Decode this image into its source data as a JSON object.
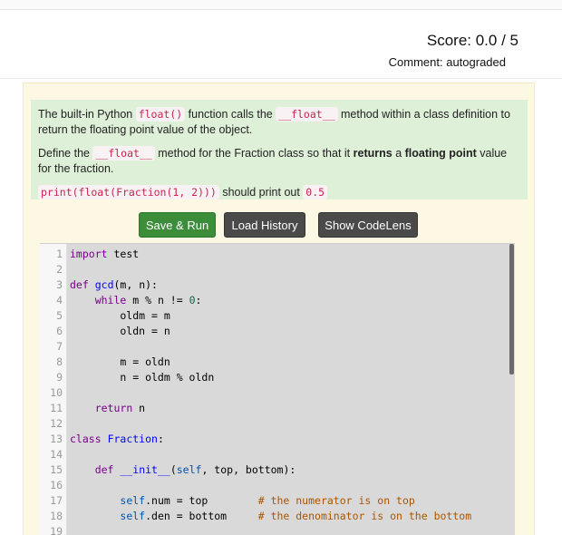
{
  "score": {
    "text": "Score: 0.0 / 5"
  },
  "comment": {
    "text": "Comment: autograded"
  },
  "prompt": {
    "p1_a": "The built-in Python ",
    "p1_code1": "float()",
    "p1_b": " function calls the ",
    "p1_code2": "__float__",
    "p1_c": " method within a class definition to return the floating point value of the object.",
    "p2_a": "Define the ",
    "p2_code": "__float__",
    "p2_b": " method for the Fraction class so that it ",
    "p2_bold1": "returns",
    "p2_c": " a ",
    "p2_bold2": "floating point",
    "p2_d": " value for the fraction.",
    "p3_code": "print(float(Fraction(1, 2)))",
    "p3_text": " should print out ",
    "p3_result": "0.5"
  },
  "buttons": {
    "save_run": "Save & Run",
    "load_history": "Load History",
    "show_codelens": "Show CodeLens"
  },
  "editor": {
    "line_numbers": [
      "1",
      "2",
      "3",
      "4",
      "5",
      "6",
      "7",
      "8",
      "9",
      "10",
      "11",
      "12",
      "13",
      "14",
      "15",
      "16",
      "17",
      "18",
      "19"
    ],
    "lines": [
      [
        {
          "t": "import",
          "c": "kw"
        },
        {
          "t": " test",
          "c": ""
        }
      ],
      [],
      [
        {
          "t": "def",
          "c": "kw"
        },
        {
          "t": " ",
          "c": ""
        },
        {
          "t": "gcd",
          "c": "def"
        },
        {
          "t": "(m, n):",
          "c": ""
        }
      ],
      [
        {
          "t": "    ",
          "c": ""
        },
        {
          "t": "while",
          "c": "kw"
        },
        {
          "t": " m % n != ",
          "c": ""
        },
        {
          "t": "0",
          "c": "num"
        },
        {
          "t": ":",
          "c": ""
        }
      ],
      [
        {
          "t": "        oldm = m",
          "c": ""
        }
      ],
      [
        {
          "t": "        oldn = n",
          "c": ""
        }
      ],
      [],
      [
        {
          "t": "        m = oldn",
          "c": ""
        }
      ],
      [
        {
          "t": "        n = oldm % oldn",
          "c": ""
        }
      ],
      [],
      [
        {
          "t": "    ",
          "c": ""
        },
        {
          "t": "return",
          "c": "kw"
        },
        {
          "t": " n",
          "c": ""
        }
      ],
      [],
      [
        {
          "t": "class",
          "c": "kw"
        },
        {
          "t": " ",
          "c": ""
        },
        {
          "t": "Fraction",
          "c": "def"
        },
        {
          "t": ":",
          "c": ""
        }
      ],
      [],
      [
        {
          "t": "    ",
          "c": ""
        },
        {
          "t": "def",
          "c": "kw"
        },
        {
          "t": " ",
          "c": ""
        },
        {
          "t": "__init__",
          "c": "def"
        },
        {
          "t": "(",
          "c": ""
        },
        {
          "t": "self",
          "c": "var2"
        },
        {
          "t": ", top, bottom):",
          "c": ""
        }
      ],
      [],
      [
        {
          "t": "        ",
          "c": ""
        },
        {
          "t": "self",
          "c": "var2"
        },
        {
          "t": ".num = top        ",
          "c": ""
        },
        {
          "t": "# the numerator is on top",
          "c": "cm"
        }
      ],
      [
        {
          "t": "        ",
          "c": ""
        },
        {
          "t": "self",
          "c": "var2"
        },
        {
          "t": ".den = bottom     ",
          "c": ""
        },
        {
          "t": "# the denominator is on the bottom",
          "c": "cm"
        }
      ],
      []
    ]
  }
}
